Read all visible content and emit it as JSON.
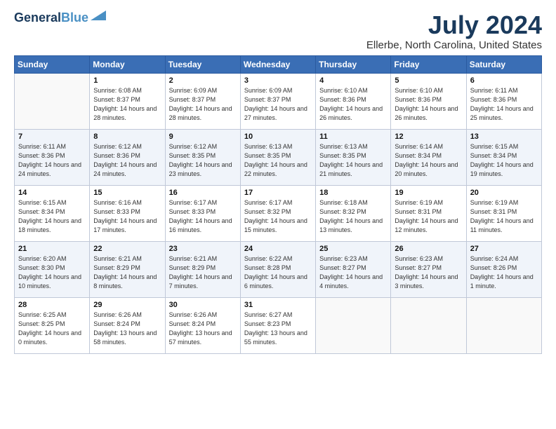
{
  "logo": {
    "line1": "General",
    "line2": "Blue"
  },
  "title": "July 2024",
  "location": "Ellerbe, North Carolina, United States",
  "days_of_week": [
    "Sunday",
    "Monday",
    "Tuesday",
    "Wednesday",
    "Thursday",
    "Friday",
    "Saturday"
  ],
  "weeks": [
    [
      {
        "day": "",
        "content": ""
      },
      {
        "day": "1",
        "content": "Sunrise: 6:08 AM\nSunset: 8:37 PM\nDaylight: 14 hours\nand 28 minutes."
      },
      {
        "day": "2",
        "content": "Sunrise: 6:09 AM\nSunset: 8:37 PM\nDaylight: 14 hours\nand 28 minutes."
      },
      {
        "day": "3",
        "content": "Sunrise: 6:09 AM\nSunset: 8:37 PM\nDaylight: 14 hours\nand 27 minutes."
      },
      {
        "day": "4",
        "content": "Sunrise: 6:10 AM\nSunset: 8:36 PM\nDaylight: 14 hours\nand 26 minutes."
      },
      {
        "day": "5",
        "content": "Sunrise: 6:10 AM\nSunset: 8:36 PM\nDaylight: 14 hours\nand 26 minutes."
      },
      {
        "day": "6",
        "content": "Sunrise: 6:11 AM\nSunset: 8:36 PM\nDaylight: 14 hours\nand 25 minutes."
      }
    ],
    [
      {
        "day": "7",
        "content": "Sunrise: 6:11 AM\nSunset: 8:36 PM\nDaylight: 14 hours\nand 24 minutes."
      },
      {
        "day": "8",
        "content": "Sunrise: 6:12 AM\nSunset: 8:36 PM\nDaylight: 14 hours\nand 24 minutes."
      },
      {
        "day": "9",
        "content": "Sunrise: 6:12 AM\nSunset: 8:35 PM\nDaylight: 14 hours\nand 23 minutes."
      },
      {
        "day": "10",
        "content": "Sunrise: 6:13 AM\nSunset: 8:35 PM\nDaylight: 14 hours\nand 22 minutes."
      },
      {
        "day": "11",
        "content": "Sunrise: 6:13 AM\nSunset: 8:35 PM\nDaylight: 14 hours\nand 21 minutes."
      },
      {
        "day": "12",
        "content": "Sunrise: 6:14 AM\nSunset: 8:34 PM\nDaylight: 14 hours\nand 20 minutes."
      },
      {
        "day": "13",
        "content": "Sunrise: 6:15 AM\nSunset: 8:34 PM\nDaylight: 14 hours\nand 19 minutes."
      }
    ],
    [
      {
        "day": "14",
        "content": "Sunrise: 6:15 AM\nSunset: 8:34 PM\nDaylight: 14 hours\nand 18 minutes."
      },
      {
        "day": "15",
        "content": "Sunrise: 6:16 AM\nSunset: 8:33 PM\nDaylight: 14 hours\nand 17 minutes."
      },
      {
        "day": "16",
        "content": "Sunrise: 6:17 AM\nSunset: 8:33 PM\nDaylight: 14 hours\nand 16 minutes."
      },
      {
        "day": "17",
        "content": "Sunrise: 6:17 AM\nSunset: 8:32 PM\nDaylight: 14 hours\nand 15 minutes."
      },
      {
        "day": "18",
        "content": "Sunrise: 6:18 AM\nSunset: 8:32 PM\nDaylight: 14 hours\nand 13 minutes."
      },
      {
        "day": "19",
        "content": "Sunrise: 6:19 AM\nSunset: 8:31 PM\nDaylight: 14 hours\nand 12 minutes."
      },
      {
        "day": "20",
        "content": "Sunrise: 6:19 AM\nSunset: 8:31 PM\nDaylight: 14 hours\nand 11 minutes."
      }
    ],
    [
      {
        "day": "21",
        "content": "Sunrise: 6:20 AM\nSunset: 8:30 PM\nDaylight: 14 hours\nand 10 minutes."
      },
      {
        "day": "22",
        "content": "Sunrise: 6:21 AM\nSunset: 8:29 PM\nDaylight: 14 hours\nand 8 minutes."
      },
      {
        "day": "23",
        "content": "Sunrise: 6:21 AM\nSunset: 8:29 PM\nDaylight: 14 hours\nand 7 minutes."
      },
      {
        "day": "24",
        "content": "Sunrise: 6:22 AM\nSunset: 8:28 PM\nDaylight: 14 hours\nand 6 minutes."
      },
      {
        "day": "25",
        "content": "Sunrise: 6:23 AM\nSunset: 8:27 PM\nDaylight: 14 hours\nand 4 minutes."
      },
      {
        "day": "26",
        "content": "Sunrise: 6:23 AM\nSunset: 8:27 PM\nDaylight: 14 hours\nand 3 minutes."
      },
      {
        "day": "27",
        "content": "Sunrise: 6:24 AM\nSunset: 8:26 PM\nDaylight: 14 hours\nand 1 minute."
      }
    ],
    [
      {
        "day": "28",
        "content": "Sunrise: 6:25 AM\nSunset: 8:25 PM\nDaylight: 14 hours\nand 0 minutes."
      },
      {
        "day": "29",
        "content": "Sunrise: 6:26 AM\nSunset: 8:24 PM\nDaylight: 13 hours\nand 58 minutes."
      },
      {
        "day": "30",
        "content": "Sunrise: 6:26 AM\nSunset: 8:24 PM\nDaylight: 13 hours\nand 57 minutes."
      },
      {
        "day": "31",
        "content": "Sunrise: 6:27 AM\nSunset: 8:23 PM\nDaylight: 13 hours\nand 55 minutes."
      },
      {
        "day": "",
        "content": ""
      },
      {
        "day": "",
        "content": ""
      },
      {
        "day": "",
        "content": ""
      }
    ]
  ]
}
